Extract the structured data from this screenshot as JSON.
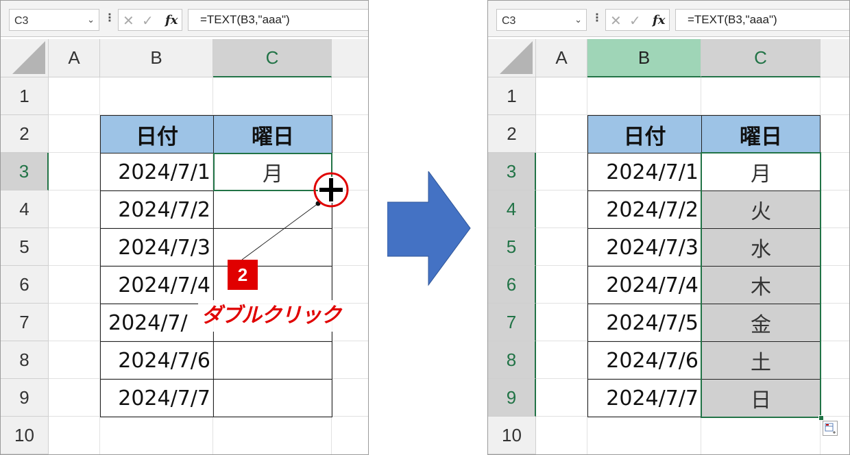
{
  "left": {
    "name_box": "C3",
    "formula": "=TEXT(B3,\"aaa\")",
    "columns": [
      "A",
      "B",
      "C"
    ],
    "rows": [
      "1",
      "2",
      "3",
      "4",
      "5",
      "6",
      "7",
      "8",
      "9",
      "10"
    ],
    "table_headers": [
      "日付",
      "曜日"
    ],
    "dates": [
      "2024/7/1",
      "2024/7/2",
      "2024/7/3",
      "2024/7/4",
      "2024/7/",
      "2024/7/6",
      "2024/7/7"
    ],
    "days": [
      "月",
      "",
      "",
      "",
      "",
      "",
      ""
    ],
    "step_number": "2",
    "step_label": "ダブルクリック"
  },
  "right": {
    "name_box": "C3",
    "formula": "=TEXT(B3,\"aaa\")",
    "columns": [
      "A",
      "B",
      "C"
    ],
    "rows": [
      "1",
      "2",
      "3",
      "4",
      "5",
      "6",
      "7",
      "8",
      "9",
      "10"
    ],
    "table_headers": [
      "日付",
      "曜日"
    ],
    "dates": [
      "2024/7/1",
      "2024/7/2",
      "2024/7/3",
      "2024/7/4",
      "2024/7/5",
      "2024/7/6",
      "2024/7/7"
    ],
    "days": [
      "月",
      "火",
      "水",
      "木",
      "金",
      "土",
      "日"
    ]
  },
  "colors": {
    "accent": "#217346",
    "table_header": "#9dc3e6",
    "arrow": "#4472c4",
    "callout": "#e00000"
  },
  "icons": {
    "cancel": "×",
    "enter": "✓",
    "fx": "fx",
    "chevron": "⌄",
    "more": "⋮"
  }
}
